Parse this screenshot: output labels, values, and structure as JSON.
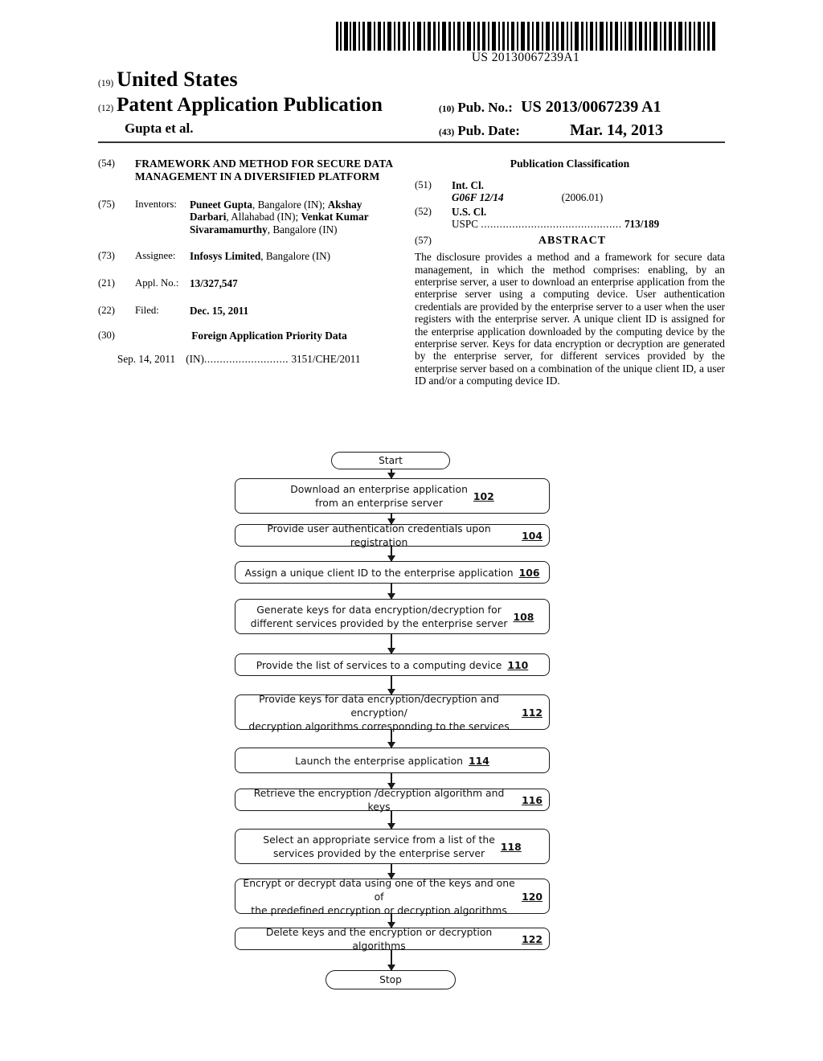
{
  "barcode": {
    "number": "US 20130067239A1"
  },
  "header": {
    "inid_19": "(19)",
    "country": "United States",
    "inid_12": "(12)",
    "doc_type": "Patent Application Publication",
    "applicant_line": "Gupta et al.",
    "inid_10": "(10)",
    "pub_no_label": "Pub. No.:",
    "pub_no_value": "US 2013/0067239 A1",
    "inid_43": "(43)",
    "pub_date_label": "Pub. Date:",
    "pub_date_value": "Mar. 14, 2013"
  },
  "left_column": {
    "title": {
      "code": "(54)",
      "text": "FRAMEWORK AND METHOD FOR SECURE DATA MANAGEMENT IN A DIVERSIFIED PLATFORM"
    },
    "inventors": {
      "code": "(75)",
      "label": "Inventors:",
      "entries": [
        {
          "name": "Puneet Gupta",
          "location": ", Bangalore (IN); "
        },
        {
          "name": "Akshay Darbari",
          "location": ", Allahabad (IN); "
        },
        {
          "name": "Venkat Kumar Sivaramamurthy",
          "location": ", Bangalore (IN)"
        }
      ]
    },
    "assignee": {
      "code": "(73)",
      "label": "Assignee:",
      "name": "Infosys Limited",
      "location": ", Bangalore (IN)"
    },
    "appl_no": {
      "code": "(21)",
      "label": "Appl. No.:",
      "value": "13/327,547"
    },
    "filed": {
      "code": "(22)",
      "label": "Filed:",
      "value": "Dec. 15, 2011"
    },
    "foreign_priority": {
      "code": "(30)",
      "heading": "Foreign Application Priority Data",
      "date": "Sep. 14, 2011",
      "country": "(IN)",
      "dots": "...........................",
      "number": "3151/CHE/2011"
    }
  },
  "right_column": {
    "pub_classification_heading": "Publication Classification",
    "int_cl": {
      "code": "(51)",
      "label": "Int. Cl.",
      "symbol": "G06F 12/14",
      "version": "(2006.01)"
    },
    "us_cl": {
      "code": "(52)",
      "label": "U.S. Cl.",
      "sub_label": "USPC",
      "dots": ".............................................",
      "value": "713/189"
    },
    "abstract": {
      "code": "(57)",
      "heading": "ABSTRACT",
      "text": "The disclosure provides a method and a framework for secure data management, in which the method comprises: enabling, by an enterprise server, a user to download an enterprise application from the enterprise server using a computing device. User authentication credentials are provided by the enterprise server to a user when the user registers with the enterprise server. A unique client ID is assigned for the enterprise application downloaded by the computing device by the enterprise server. Keys for data encryption or decryption are generated by the enterprise server, for different services provided by the enterprise server based on a combination of the unique client ID, a user ID and/or a computing device ID."
    }
  },
  "flowchart": {
    "type": "flowchart",
    "start_label": "Start",
    "stop_label": "Stop",
    "steps": [
      {
        "text": "Download an enterprise application\nfrom an enterprise server",
        "ref": "102",
        "lines": 2
      },
      {
        "text": "Provide user authentication credentials upon registration",
        "ref": "104",
        "lines": 1
      },
      {
        "text": "Assign a unique client ID to the enterprise application",
        "ref": "106",
        "lines": 1
      },
      {
        "text": "Generate keys for data encryption/decryption for\ndifferent services provided by the enterprise server",
        "ref": "108",
        "lines": 2
      },
      {
        "text": "Provide the list of services to a computing device",
        "ref": "110",
        "lines": 1
      },
      {
        "text": "Provide keys for data encryption/decryption and encryption/\ndecryption algorithms corresponding to the services",
        "ref": "112",
        "lines": 2
      },
      {
        "text": "Launch the enterprise application",
        "ref": "114",
        "lines": 1
      },
      {
        "text": "Retrieve the encryption /decryption algorithm  and keys",
        "ref": "116",
        "lines": 1
      },
      {
        "text": "Select an appropriate service from a list of the\nservices provided by the enterprise server",
        "ref": "118",
        "lines": 2
      },
      {
        "text": "Encrypt or decrypt data using one of the keys and  one of\nthe  predefined encryption or decryption algorithms",
        "ref": "120",
        "lines": 2
      },
      {
        "text": "Delete keys and the encryption or decryption algorithms",
        "ref": "122",
        "lines": 1
      }
    ]
  }
}
